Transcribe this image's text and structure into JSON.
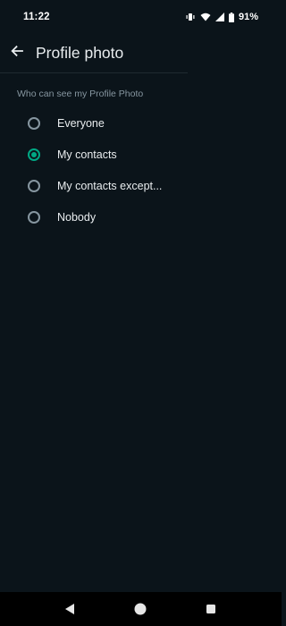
{
  "status_bar": {
    "time": "11:22",
    "battery_percent": "91%",
    "icons": [
      "vibrate-icon",
      "wifi-icon",
      "cellular-signal-icon",
      "battery-icon"
    ]
  },
  "header": {
    "back_icon": "arrow-left-icon",
    "title": "Profile photo"
  },
  "section": {
    "label": "Who can see my Profile Photo"
  },
  "options": [
    {
      "label": "Everyone",
      "selected": false
    },
    {
      "label": "My contacts",
      "selected": true
    },
    {
      "label": "My contacts except...",
      "selected": false
    },
    {
      "label": "Nobody",
      "selected": false
    }
  ],
  "colors": {
    "background": "#0b141a",
    "accent": "#00a884",
    "radio_unselected": "#8696a0",
    "text_primary": "#e9edef",
    "text_secondary": "#8696a0"
  },
  "nav_bar": {
    "buttons": [
      "nav-back-icon",
      "nav-home-icon",
      "nav-recents-icon"
    ]
  }
}
